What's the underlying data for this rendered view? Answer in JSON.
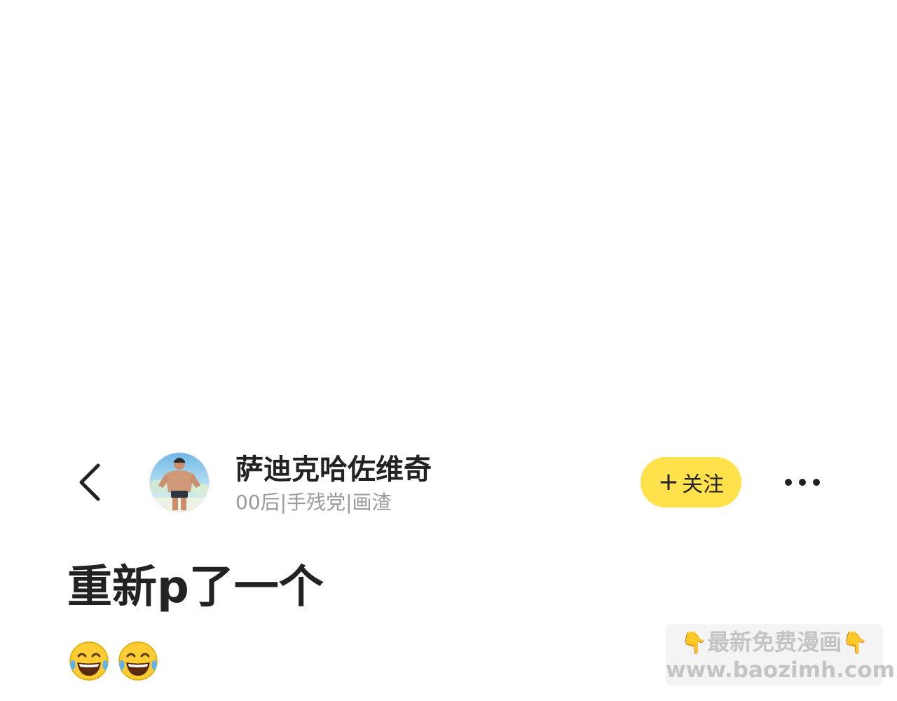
{
  "header": {
    "back_icon": "chevron-left-icon",
    "avatar_icon": "avatar-illustration",
    "user_name": "萨迪克哈佐维奇",
    "user_tags": "00后|手残党|画渣",
    "follow_label": "关注",
    "follow_plus": "+",
    "more_icon": "more-dots-icon"
  },
  "post": {
    "title": "重新p了一个",
    "emojis": [
      "😂",
      "😂"
    ]
  },
  "watermark": {
    "hand_left": "👇",
    "line1": "最新免费漫画",
    "hand_right": "👇",
    "line2": "www.baozimh.com"
  },
  "colors": {
    "follow_bg": "#ffe14b",
    "text_primary": "#222222",
    "text_secondary": "#9a9a9a",
    "watermark_text": "#c4c4c4"
  }
}
